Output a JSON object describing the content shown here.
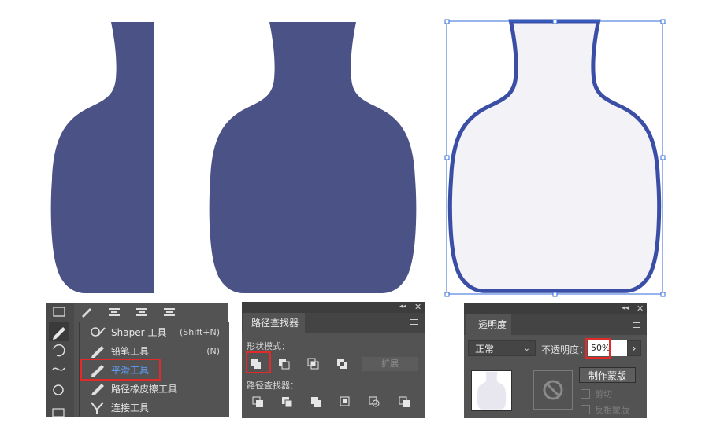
{
  "canvas": {
    "vase_color": "#4a5286",
    "selected_fill": "#f3f2f7",
    "selected_stroke": "#3b4ea6",
    "selection_color": "#2f6bd8"
  },
  "tools_panel": {
    "flyout_items": [
      {
        "label": "Shaper 工具",
        "shortcut": "(Shift+N)",
        "icon": "shaper-icon"
      },
      {
        "label": "铅笔工具",
        "shortcut": "(N)",
        "icon": "pencil-icon"
      },
      {
        "label": "平滑工具",
        "shortcut": "",
        "icon": "smooth-icon",
        "active": true
      },
      {
        "label": "路径橡皮擦工具",
        "shortcut": "",
        "icon": "path-eraser-icon"
      },
      {
        "label": "连接工具",
        "shortcut": "",
        "icon": "join-icon"
      }
    ]
  },
  "pathfinder": {
    "tab_label": "路径查找器",
    "shape_modes_label": "形状模式：",
    "pathfinders_label": "路径查找器：",
    "expand_label": "扩展"
  },
  "transparency": {
    "tab_label": "透明度",
    "blend_mode": "正常",
    "opacity_label": "不透明度：",
    "opacity_value": "50%",
    "make_mask_label": "制作蒙版",
    "clip_label": "剪切",
    "invert_mask_label": "反相蒙版"
  }
}
